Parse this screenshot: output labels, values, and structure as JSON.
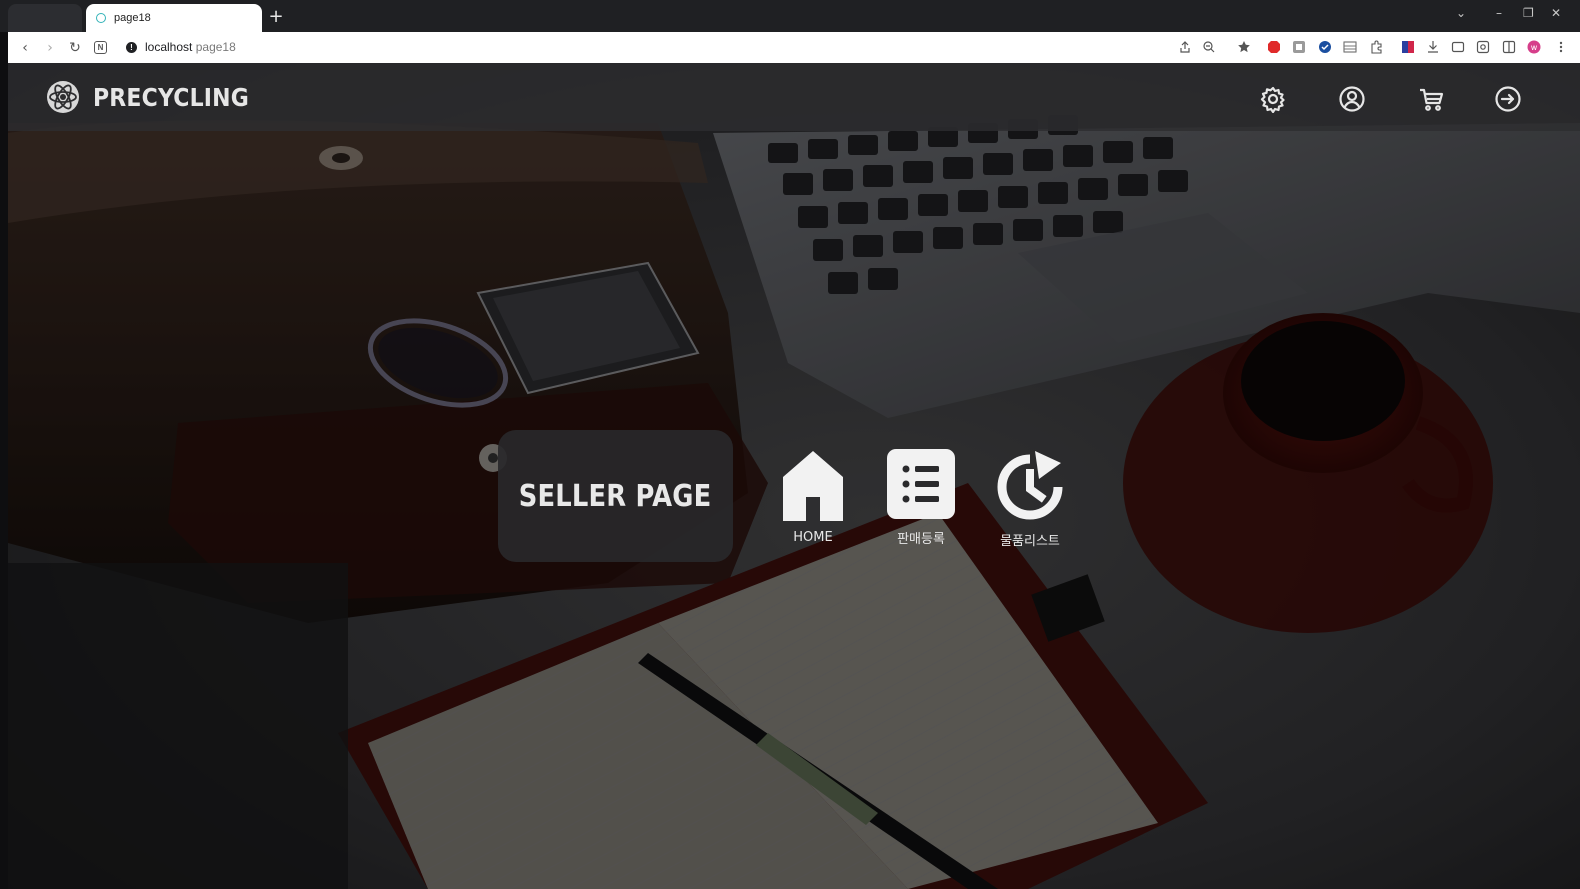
{
  "browser": {
    "tab_title": "page18",
    "new_tab": "+",
    "url_host": "localhost",
    "url_path": "page18"
  },
  "header": {
    "brand": "PRECYCLING",
    "icons": [
      "settings-icon",
      "account-icon",
      "cart-icon",
      "login-icon"
    ]
  },
  "hero": {
    "title": "SELLER PAGE"
  },
  "menu": {
    "items": [
      {
        "label": "HOME",
        "icon": "home-icon"
      },
      {
        "label": "판매등록",
        "icon": "list-icon"
      },
      {
        "label": "물품리스트",
        "icon": "history-icon"
      }
    ]
  },
  "colors": {
    "header_bg": "#2d2d2f",
    "card_bg": "#28282a",
    "text": "#e8e8e8",
    "accent_red": "#8a1f1a"
  }
}
